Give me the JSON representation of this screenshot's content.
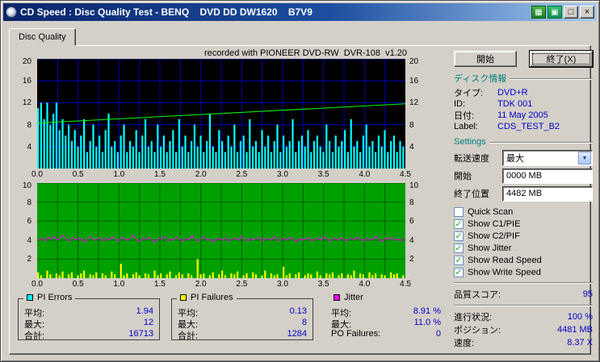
{
  "window": {
    "title": "CD Speed : Disc Quality Test - BENQ    DVD DD DW1620    B7V9"
  },
  "tab": {
    "label": "Disc Quality"
  },
  "chart_note": "recorded with PIONEER DVD-RW  DVR-108  v1.20",
  "chart_data": [
    {
      "type": "bar",
      "title": "PI Errors / Write Speed",
      "x_range": [
        0,
        4.5
      ],
      "x_ticks": [
        "0.0",
        "0.5",
        "1.0",
        "1.5",
        "2.0",
        "2.5",
        "3.0",
        "3.5",
        "4.0",
        "4.5"
      ],
      "y_range": [
        0,
        20
      ],
      "y_ticks": [
        20,
        16,
        12,
        8,
        4
      ],
      "bg": "#000000",
      "grid": "#0000b8",
      "y_left_color": "#000000",
      "y_right_color": "#000000",
      "series": [
        {
          "name": "PI Errors",
          "type": "bar",
          "color": "#00ffff",
          "values": [
            11,
            12,
            9,
            12,
            8,
            10,
            12,
            7,
            9,
            6,
            8,
            5,
            7,
            4,
            6,
            9,
            3,
            5,
            8,
            4,
            6,
            3,
            7,
            10,
            4,
            5,
            3,
            6,
            8,
            3,
            5,
            4,
            7,
            3,
            6,
            9,
            4,
            5,
            3,
            8,
            4,
            6,
            3,
            5,
            7,
            3,
            9,
            4,
            6,
            3,
            5,
            8,
            4,
            6,
            3,
            5,
            10,
            4,
            3,
            7,
            5,
            3,
            6,
            4,
            8,
            3,
            5,
            6,
            3,
            9,
            4,
            5,
            3,
            7,
            4,
            6,
            3,
            5,
            8,
            3,
            6,
            4,
            5,
            9,
            3,
            5,
            6,
            4,
            7,
            3,
            5,
            6,
            4,
            3,
            8,
            5,
            3,
            6,
            4,
            5,
            7,
            3,
            9,
            4,
            5,
            3,
            6,
            8,
            4,
            5,
            3,
            6,
            4,
            7,
            3,
            5,
            6,
            3,
            5,
            4
          ]
        },
        {
          "name": "Write Speed",
          "type": "line",
          "color": "#00ff00",
          "start": 8.3,
          "end": 11.8
        }
      ]
    },
    {
      "type": "bar",
      "title": "PI Failures / Jitter",
      "x_range": [
        0,
        4.5
      ],
      "x_ticks": [
        "0.0",
        "0.5",
        "1.0",
        "1.5",
        "2.0",
        "2.5",
        "3.0",
        "3.5",
        "4.0",
        "4.5"
      ],
      "y_range": [
        0,
        10
      ],
      "y_ticks": [
        10,
        8,
        6,
        4,
        2
      ],
      "bg": "#00a000",
      "grid": "#006000",
      "y_left_color": "#000000",
      "y_right_color": "#000000",
      "series": [
        {
          "name": "PI Failures",
          "type": "bar",
          "color": "#ffff00",
          "values": [
            0.6,
            0.3,
            0,
            0.8,
            0.4,
            0,
            0.5,
            0.3,
            0.7,
            0,
            0.4,
            0.6,
            0,
            0.3,
            0.5,
            0.8,
            0,
            0.4,
            0.3,
            0.6,
            0,
            0.5,
            0.3,
            0,
            0.7,
            0.4,
            0,
            1.5,
            0.3,
            0.5,
            0,
            0.4,
            0.6,
            0.3,
            0,
            0.5,
            0.4,
            0,
            0.8,
            0.3,
            0.5,
            0,
            0.4,
            0.7,
            0,
            0.3,
            0.6,
            0.4,
            0,
            0.5,
            0.3,
            0,
            2,
            0.4,
            0.5,
            0,
            0.3,
            0.6,
            0,
            0.4,
            0.8,
            0.3,
            0,
            0.5,
            0.4,
            0.7,
            0,
            0.3,
            0.5,
            0,
            0.6,
            0.4,
            0,
            0.3,
            0.8,
            0,
            0.5,
            0.3,
            0.4,
            0,
            1.2,
            0.3,
            0.5,
            0,
            0.4,
            0.6,
            0,
            0.3,
            0.5,
            0.4,
            0,
            0.7,
            0.3,
            0,
            0.5,
            0.4,
            0.6,
            0,
            0.3,
            0.5,
            0,
            0.4,
            0.3,
            0.8,
            0,
            0.5,
            0.4,
            0,
            0.6,
            0.3,
            0.5,
            0,
            0.4,
            0.3,
            0,
            0.6,
            0.4,
            0.5,
            0,
            0.3
          ]
        },
        {
          "name": "Jitter",
          "type": "line",
          "color": "#ff00ff",
          "values": [
            4.0,
            4.2,
            3.9,
            4.3,
            4.1,
            4.4,
            4.0,
            4.2,
            4.5,
            4.1,
            3.9,
            4.3,
            4.0,
            4.2,
            4.1,
            3.8,
            4.2,
            4.4,
            4.0,
            4.1,
            4.3,
            3.9,
            4.2,
            4.0,
            4.4,
            4.1,
            3.9,
            4.3,
            4.1,
            4.0,
            4.2,
            4.5,
            4.0,
            3.9,
            4.2,
            4.1,
            4.3,
            4.0,
            3.8,
            4.2,
            4.1,
            4.4,
            3.9,
            4.1,
            4.0,
            4.3,
            4.1,
            3.9,
            4.2,
            4.0,
            4.5,
            4.1,
            3.9,
            4.2,
            4.3,
            4.0,
            4.1,
            3.8,
            4.2,
            4.1,
            4.0,
            4.3,
            3.9,
            4.1,
            4.2,
            4.0,
            4.4,
            4.1,
            3.9,
            4.2,
            4.0,
            4.1,
            4.3,
            3.9,
            4.2,
            4.1,
            4.0,
            4.4,
            3.9,
            4.1,
            4.2,
            4.0,
            4.3,
            4.1,
            3.8,
            4.2,
            4.0,
            4.1,
            4.3,
            3.9,
            4.1,
            4.2,
            4.0,
            4.4,
            4.1,
            3.9,
            4.2,
            4.1,
            4.0,
            4.3,
            3.9,
            4.1,
            4.2,
            4.0,
            4.3,
            4.1,
            3.9,
            4.2,
            4.0,
            4.1,
            4.4,
            4.0,
            3.9,
            4.2,
            4.1,
            4.3,
            4.0,
            4.1,
            3.9,
            4.2
          ]
        }
      ]
    }
  ],
  "panel": {
    "start_button": "開始",
    "exit_button": "終了(X)",
    "disc_info": {
      "header": "ディスク情報",
      "rows": [
        {
          "label": "タイプ:",
          "value": "DVD+R"
        },
        {
          "label": "ID:",
          "value": "TDK 001"
        },
        {
          "label": "日付:",
          "value": "11 May 2005"
        },
        {
          "label": "Label:",
          "value": "CDS_TEST_B2"
        }
      ]
    },
    "settings": {
      "header": "Settings",
      "speed_label": "転送速度",
      "speed_value": "最大",
      "start_label": "開始",
      "start_value": "0000 MB",
      "end_label": "終了位置",
      "end_value": "4482 MB",
      "checkboxes": [
        {
          "label": "Quick Scan",
          "checked": false
        },
        {
          "label": "Show C1/PIE",
          "checked": true
        },
        {
          "label": "Show C2/PIF",
          "checked": true
        },
        {
          "label": "Show Jitter",
          "checked": true
        },
        {
          "label": "Show Read Speed",
          "checked": true
        },
        {
          "label": "Show Write Speed",
          "checked": true
        }
      ]
    },
    "score": {
      "label": "品質スコア:",
      "value": "95"
    },
    "progress": [
      {
        "label": "進行状況:",
        "value": "100 %"
      },
      {
        "label": "ポジション:",
        "value": "4481 MB"
      },
      {
        "label": "速度:",
        "value": "8.37 X"
      }
    ]
  },
  "stats_boxes": [
    {
      "title": "PI Errors",
      "color": "#00ffff",
      "rows": [
        [
          "平均:",
          "1.94"
        ],
        [
          "最大:",
          "12"
        ],
        [
          "合計:",
          "16713"
        ]
      ]
    },
    {
      "title": "PI Failures",
      "color": "#ffff00",
      "rows": [
        [
          "平均:",
          "0.13"
        ],
        [
          "最大:",
          "8"
        ],
        [
          "合計:",
          "1284"
        ]
      ]
    },
    {
      "title": "Jitter",
      "color": "#ff00ff",
      "rows": [
        [
          "平均:",
          "8.91 %"
        ],
        [
          "最大:",
          "11.0 %"
        ],
        [
          "PO Failures:",
          "0"
        ]
      ]
    }
  ]
}
